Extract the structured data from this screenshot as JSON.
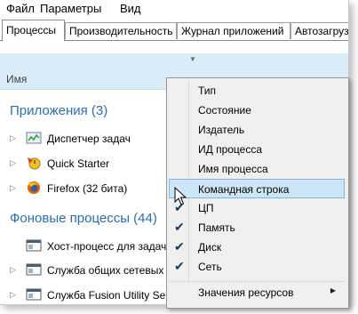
{
  "menu": {
    "file": "Файл",
    "options": "Параметры",
    "view": "Вид"
  },
  "tabs": [
    "Процессы",
    "Производительность",
    "Журнал приложений",
    "Автозагрузка"
  ],
  "header": {
    "name_column": "Имя"
  },
  "groups": {
    "apps_title": "Приложения (3)",
    "background_title": "Фоновые процессы (44)"
  },
  "apps": [
    {
      "label": "Диспетчер задач",
      "icon": "task-manager-icon"
    },
    {
      "label": "Quick Starter",
      "icon": "quick-starter-icon"
    },
    {
      "label": "Firefox (32 бита)",
      "icon": "firefox-icon"
    }
  ],
  "background": [
    {
      "label": "Хост-процесс для задач W",
      "icon": "process-window-icon"
    },
    {
      "label": "Служба общих сетевых р",
      "icon": "process-window-icon"
    },
    {
      "label": "Служба Fusion Utility Ser",
      "icon": "process-window-icon"
    }
  ],
  "context_menu": {
    "items": [
      {
        "label": "Тип",
        "checked": false
      },
      {
        "label": "Состояние",
        "checked": false
      },
      {
        "label": "Издатель",
        "checked": false
      },
      {
        "label": "ИД процесса",
        "checked": false
      },
      {
        "label": "Имя процесса",
        "checked": false
      },
      {
        "label": "Командная строка",
        "checked": false,
        "highlighted": true
      },
      {
        "label": "ЦП",
        "checked": true
      },
      {
        "label": "Память",
        "checked": true
      },
      {
        "label": "Диск",
        "checked": true
      },
      {
        "label": "Сеть",
        "checked": true
      }
    ],
    "resource_values": "Значения ресурсов"
  },
  "colors": {
    "header_bg": "#dbecf9",
    "group_text": "#2a6fb0",
    "highlight": "#cde6f7"
  }
}
